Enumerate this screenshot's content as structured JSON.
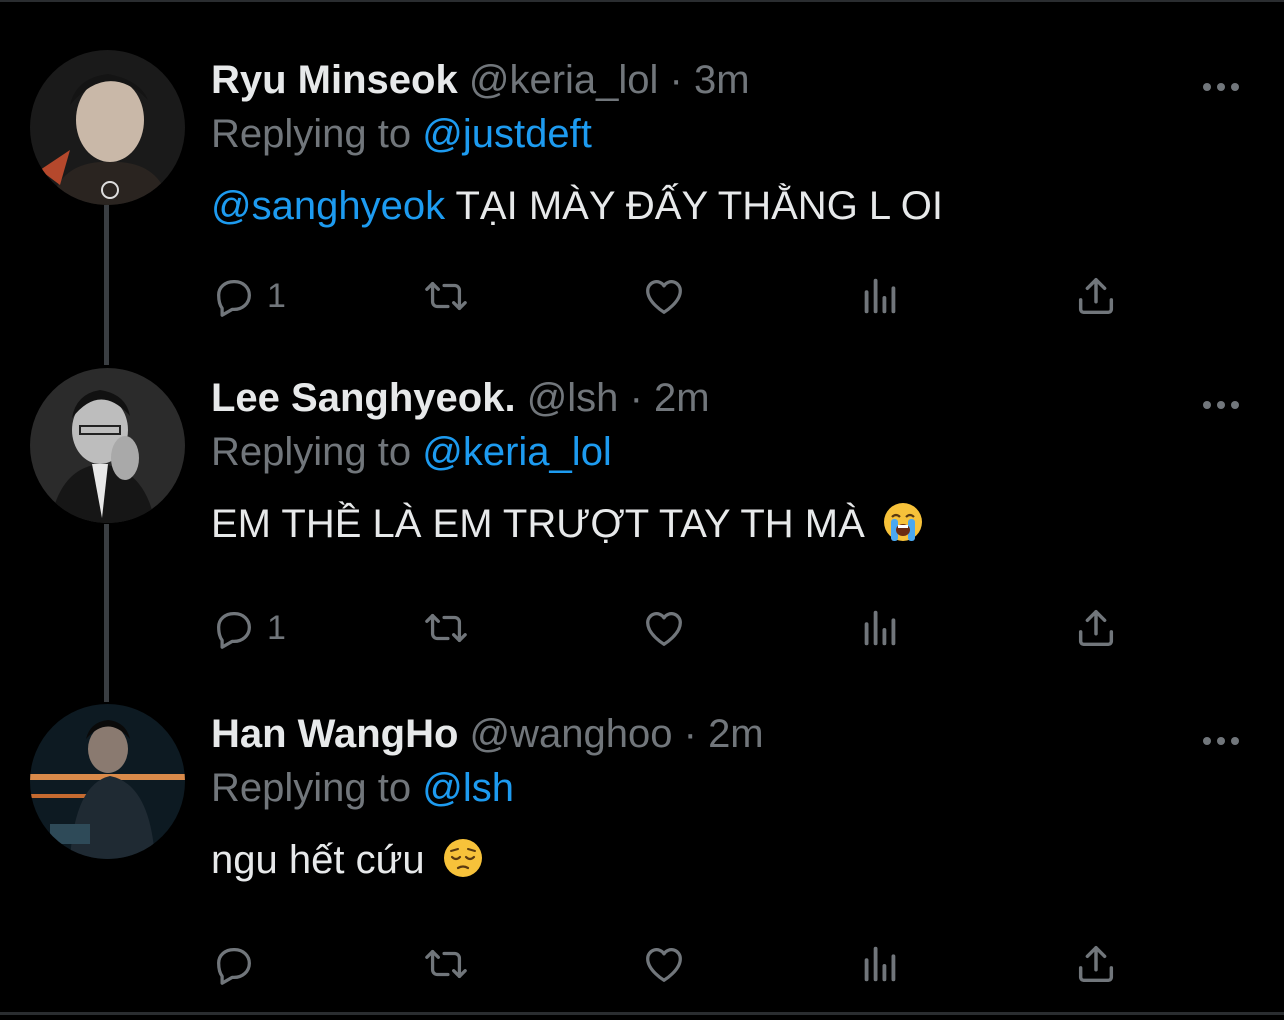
{
  "tweets": [
    {
      "name": "Ryu Minseok",
      "handle": "@keria_lol",
      "separator": "·",
      "time": "3m",
      "replying_prefix": "Replying to",
      "replying_to": "@justdeft",
      "body_mention": "@sanghyeok",
      "body_text": "TẠI MÀY ĐẤY THẰNG L OI",
      "body_emoji": "",
      "reply_count": "1",
      "avatar_colors": [
        "#1a1a1a",
        "#c9b8a8",
        "#3b2b22"
      ]
    },
    {
      "name": "Lee Sanghyeok.",
      "handle": "@lsh",
      "separator": "·",
      "time": "2m",
      "replying_prefix": "Replying to",
      "replying_to": "@keria_lol",
      "body_mention": "",
      "body_text": "EM THỀ LÀ EM TRƯỢT TAY TH MÀ",
      "body_emoji": "loudly-crying-face-emoji",
      "reply_count": "1",
      "avatar_colors": [
        "#2b2b2b",
        "#bdbdbd",
        "#111111"
      ]
    },
    {
      "name": "Han WangHo",
      "handle": "@wanghoo",
      "separator": "·",
      "time": "2m",
      "replying_prefix": "Replying to",
      "replying_to": "@lsh",
      "body_mention": "",
      "body_text": "ngu hết cứu",
      "body_emoji": "pensive-face-emoji",
      "reply_count": "",
      "avatar_colors": [
        "#0d1a22",
        "#d98a4a",
        "#1f2a33"
      ]
    }
  ],
  "icons": {
    "reply": "reply-icon",
    "retweet": "retweet-icon",
    "like": "heart-icon",
    "analytics": "analytics-icon",
    "share": "share-icon",
    "more": "more-icon"
  },
  "colors": {
    "background": "#000000",
    "text": "#e7e9ea",
    "secondary": "#71767b",
    "link": "#1d9bf0",
    "thread_line": "#3a3e42"
  }
}
